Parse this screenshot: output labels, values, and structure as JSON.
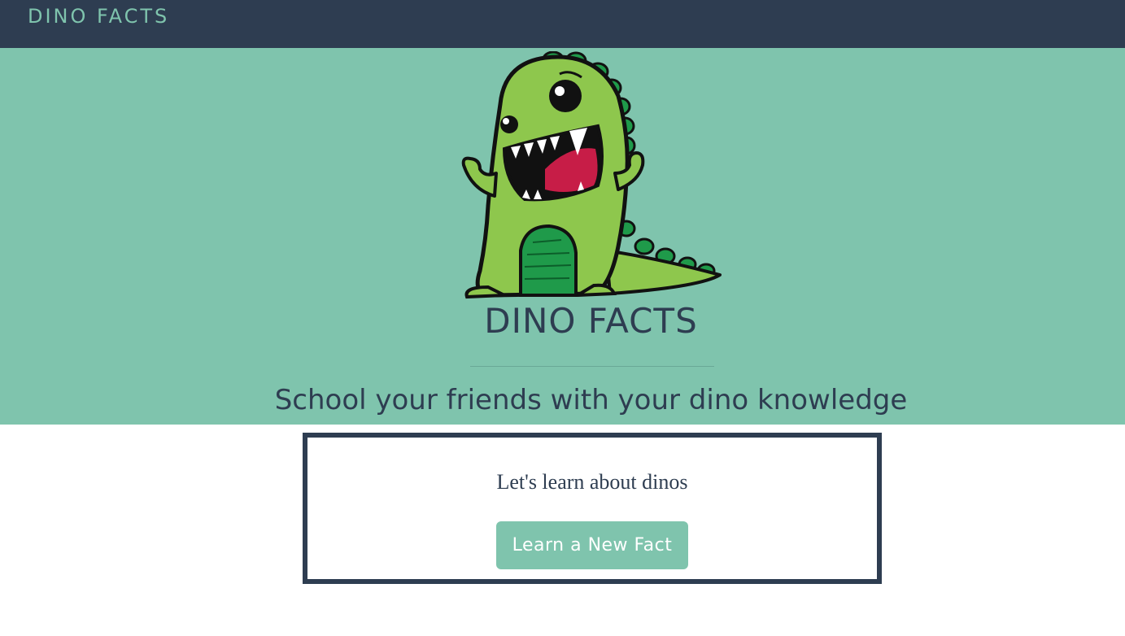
{
  "navbar": {
    "brand": "DINO FACTS"
  },
  "hero": {
    "logo_icon": "dinosaur-icon",
    "title": "DINO FACTS",
    "tagline": "School your friends with your dino knowledge"
  },
  "card": {
    "text": "Let's learn about dinos",
    "button_label": "Learn a New Fact"
  },
  "colors": {
    "navbar_bg": "#2e3d51",
    "accent": "#7fc4ad",
    "text_dark": "#2e3d51",
    "dino_green": "#8ec74d",
    "dino_dark_green": "#1f9a4a",
    "tongue": "#c71d47"
  }
}
